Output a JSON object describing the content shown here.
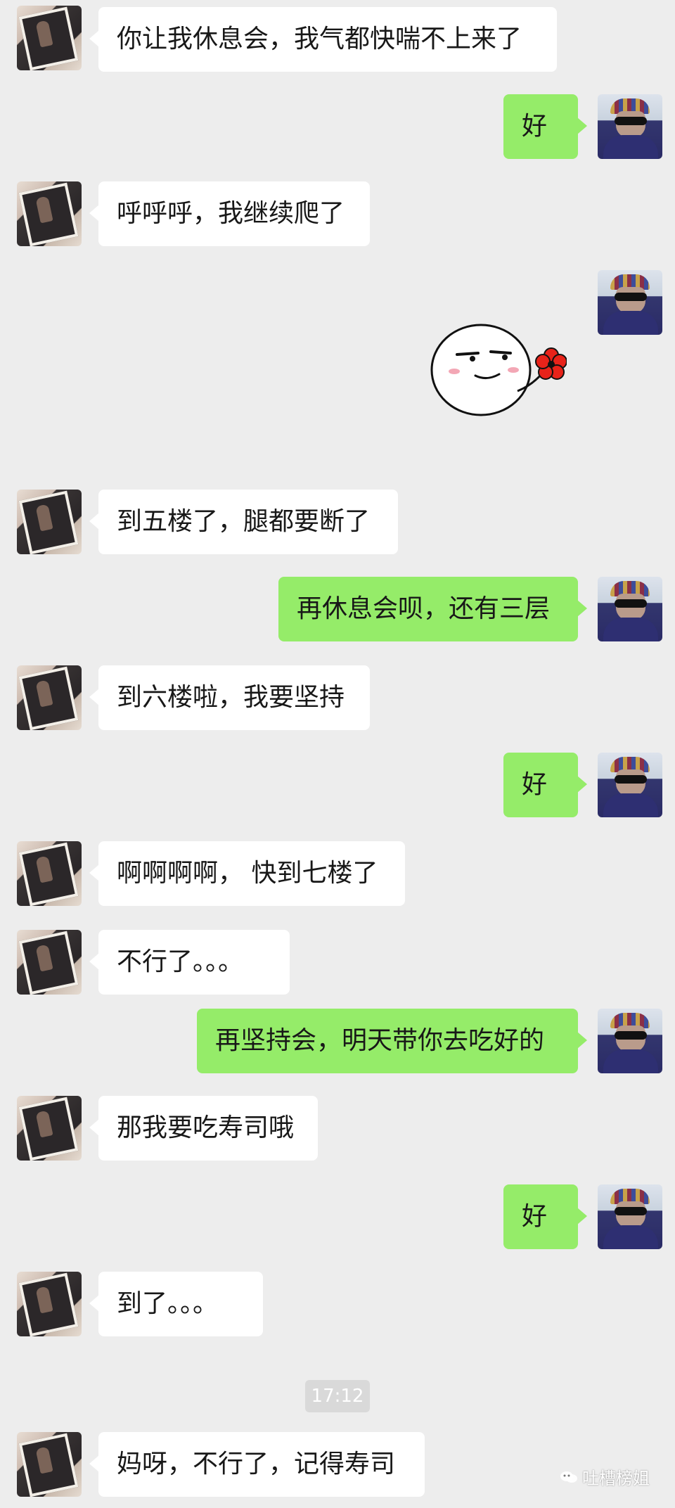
{
  "messages": [
    {
      "side": "in",
      "text": "你让我休息会，我气都快喘不上来了"
    },
    {
      "side": "out",
      "text": "好"
    },
    {
      "side": "in",
      "text": "呼呼呼，我继续爬了"
    },
    {
      "side": "out",
      "text": "",
      "sticker": "smirk-face-with-flower-sticker"
    },
    {
      "side": "in",
      "text": "到五楼了，腿都要断了"
    },
    {
      "side": "out",
      "text": "再休息会呗，还有三层"
    },
    {
      "side": "in",
      "text": "到六楼啦，我要坚持"
    },
    {
      "side": "out",
      "text": "好"
    },
    {
      "side": "in",
      "text": "啊啊啊啊， 快到七楼了"
    },
    {
      "side": "in",
      "text": "不行了。。。"
    },
    {
      "side": "out",
      "text": "再坚持会，明天带你去吃好的"
    },
    {
      "side": "in",
      "text": "那我要吃寿司哦"
    },
    {
      "side": "out",
      "text": "好"
    },
    {
      "side": "in",
      "text": "到了。。。"
    },
    {
      "side": "in",
      "text": "妈呀，不行了，记得寿司"
    }
  ],
  "timestamp": "17:12",
  "watermark": "吐槽榜姐",
  "colors": {
    "background": "#ededed",
    "incoming_bubble": "#ffffff",
    "outgoing_bubble": "#95ec69"
  }
}
